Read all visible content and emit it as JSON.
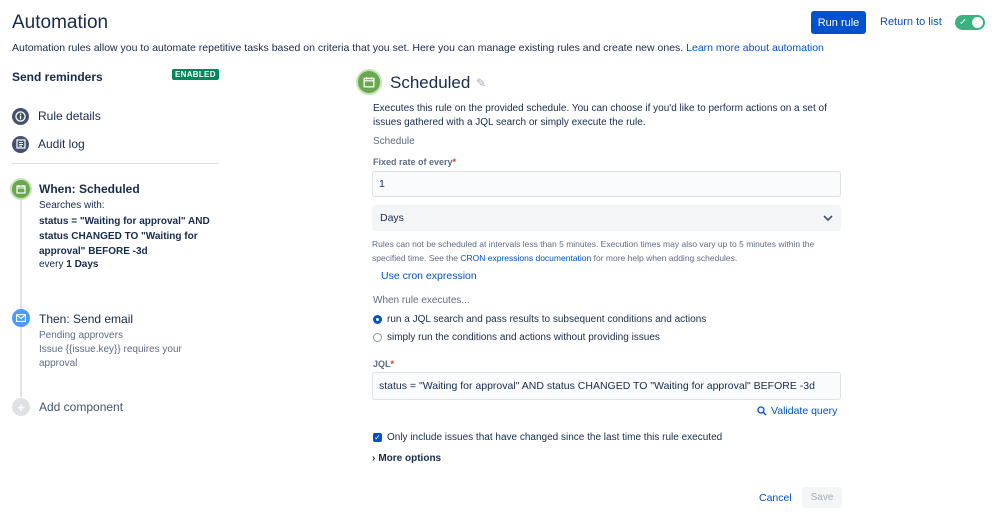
{
  "header": {
    "title": "Automation",
    "run_rule_label": "Run rule",
    "return_label": "Return to list",
    "toggle_enabled": true,
    "description": "Automation rules allow you to automate repetitive tasks based on criteria that you set. Here you can manage existing rules and create new ones.",
    "learn_more": "Learn more about automation"
  },
  "sidebar": {
    "rule_name": "Send reminders",
    "status_badge": "ENABLED",
    "nav": [
      {
        "label": "Rule details",
        "icon": "info-icon"
      },
      {
        "label": "Audit log",
        "icon": "list-icon"
      }
    ],
    "trigger": {
      "title": "When: Scheduled",
      "searches_label": "Searches with:",
      "query": "status = \"Waiting for approval\" AND status CHANGED TO \"Waiting for approval\" BEFORE -3d",
      "every_prefix": "every",
      "every_value": "1 Days"
    },
    "action": {
      "title": "Then: Send email",
      "line1": "Pending approvers",
      "line2": "Issue {{issue.key}} requires your approval"
    },
    "add_component": "Add component"
  },
  "panel": {
    "title": "Scheduled",
    "description": "Executes this rule on the provided schedule. You can choose if you'd like to perform actions on a set of issues gathered with a JQL search or simply execute the rule.",
    "schedule_label": "Schedule",
    "fixed_rate_label": "Fixed rate of every",
    "fixed_rate_value": "1",
    "unit_value": "Days",
    "help_part1": "Rules can not be scheduled at intervals less than 5 minutes. Execution times may also vary up to 5 minutes within the specified time. See the",
    "help_link": "CRON expressions documentation",
    "help_part2": "for more help when adding schedules.",
    "cron_link": "Use cron expression",
    "when_executes": "When rule executes...",
    "radio_1": "run a JQL search and pass results to subsequent conditions and actions",
    "radio_2": "simply run the conditions and actions without providing issues",
    "radio_selected": 1,
    "jql_label": "JQL",
    "jql_value": "status = \"Waiting for approval\" AND status CHANGED TO \"Waiting for approval\"  BEFORE -3d",
    "validate_label": "Validate query",
    "checkbox_label": "Only include issues that have changed since the last time this rule executed",
    "checkbox_checked": true,
    "more_options": "More options",
    "cancel_label": "Cancel",
    "save_label": "Save"
  },
  "colors": {
    "primary": "#0052cc",
    "success": "#00875a",
    "toggle": "#36b37e",
    "trigger_green": "#6aa84f",
    "action_blue": "#4c9aff"
  }
}
